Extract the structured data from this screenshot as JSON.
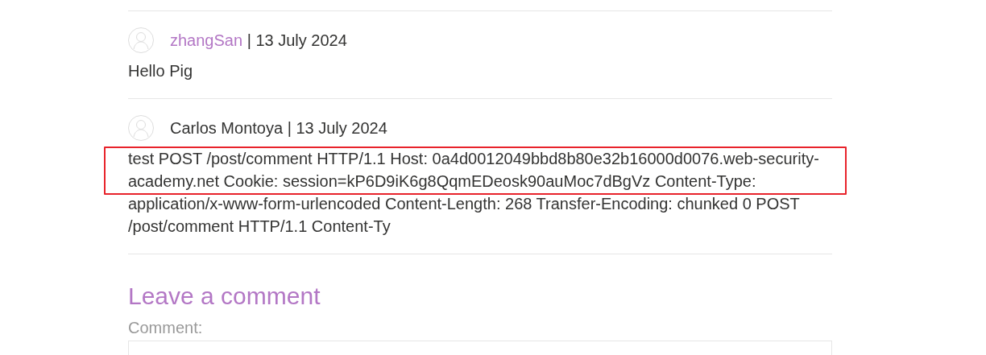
{
  "comments": [
    {
      "author": "zhangSan",
      "author_linked": true,
      "separator": "|",
      "date": "13 July 2024",
      "body": "Hello Pig",
      "highlighted": false
    },
    {
      "author": "Carlos Montoya",
      "author_linked": false,
      "separator": "|",
      "date": "13 July 2024",
      "body": "test POST /post/comment HTTP/1.1 Host: 0a4d0012049bbd8b80e32b16000d0076.web-security-academy.net Cookie: session=kP6D9iK6g8QqmEDeosk90auMoc7dBgVz Content-Type: application/x-www-form-urlencoded Content-Length: 268 Transfer-Encoding: chunked 0 POST /post/comment HTTP/1.1 Content-Ty",
      "highlighted": true
    }
  ],
  "form": {
    "heading": "Leave a comment",
    "comment_label": "Comment:"
  }
}
